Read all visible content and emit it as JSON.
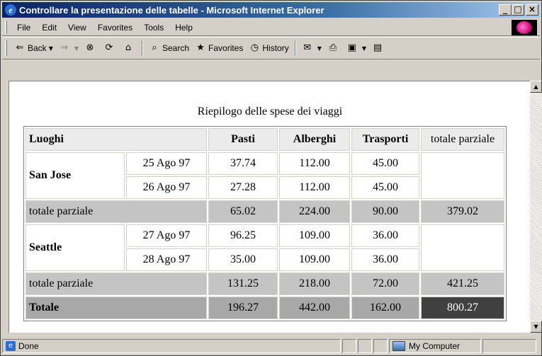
{
  "window": {
    "title": "Controllare la presentazione delle tabelle - Microsoft Internet Explorer",
    "buttons": {
      "minimize": "_",
      "maximize": "□",
      "close": "×"
    }
  },
  "menu": [
    "File",
    "Edit",
    "View",
    "Favorites",
    "Tools",
    "Help"
  ],
  "toolbar": {
    "back": "Back",
    "search": "Search",
    "favorites": "Favorites",
    "history": "History"
  },
  "content": {
    "caption": "Riepilogo delle spese dei viaggi",
    "headers": [
      "Luoghi",
      "Pasti",
      "Alberghi",
      "Trasporti",
      "totale parziale"
    ],
    "groups": [
      {
        "city": "San Jose",
        "rows": [
          {
            "date": "25 Ago 97",
            "pasti": "37.74",
            "alberghi": "112.00",
            "trasporti": "45.00"
          },
          {
            "date": "26 Ago 97",
            "pasti": "27.28",
            "alberghi": "112.00",
            "trasporti": "45.00"
          }
        ],
        "subtotal": {
          "label": "totale parziale",
          "pasti": "65.02",
          "alberghi": "224.00",
          "trasporti": "90.00",
          "totale": "379.02"
        }
      },
      {
        "city": "Seattle",
        "rows": [
          {
            "date": "27 Ago 97",
            "pasti": "96.25",
            "alberghi": "109.00",
            "trasporti": "36.00"
          },
          {
            "date": "28 Ago 97",
            "pasti": "35.00",
            "alberghi": "109.00",
            "trasporti": "36.00"
          }
        ],
        "subtotal": {
          "label": "totale parziale",
          "pasti": "131.25",
          "alberghi": "218.00",
          "trasporti": "72.00",
          "totale": "421.25"
        }
      }
    ],
    "total": {
      "label": "Totale",
      "pasti": "196.27",
      "alberghi": "442.00",
      "trasporti": "162.00",
      "totale": "800.27"
    }
  },
  "status": {
    "text": "Done",
    "zone": "My Computer"
  }
}
